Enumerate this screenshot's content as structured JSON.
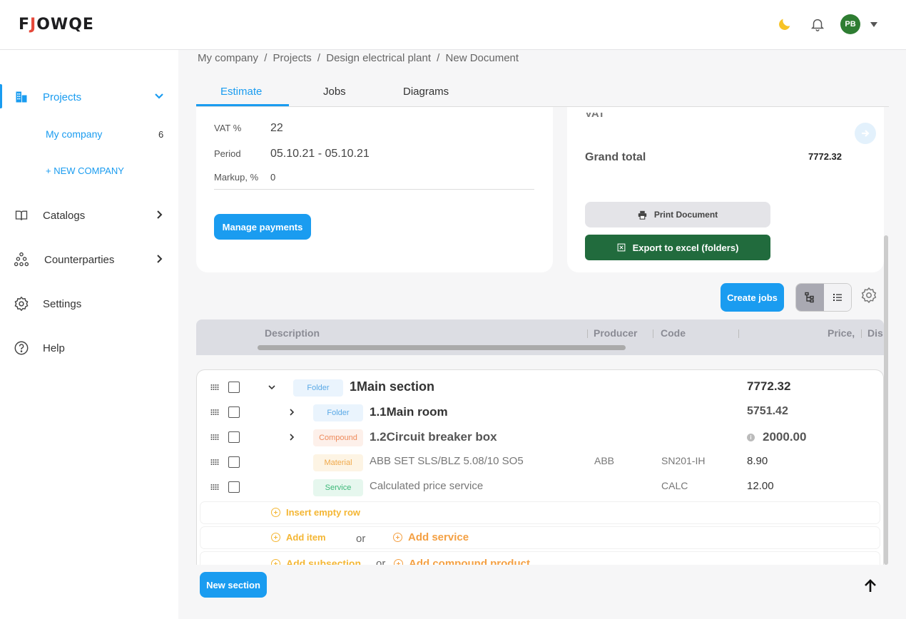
{
  "app": {
    "logo_left": "F",
    "logo_accent": "J",
    "logo_right": "OWQE",
    "user_initials": "PB"
  },
  "colors": {
    "accent": "#1a9cf0",
    "excel_green": "#216b3d",
    "avatar_green": "#2e7d32"
  },
  "sidebar": {
    "projects": "Projects",
    "my_company": "My company",
    "my_company_count": "6",
    "new_company": "+ NEW COMPANY",
    "catalogs": "Catalogs",
    "counterparties": "Counterparties",
    "settings": "Settings",
    "help": "Help"
  },
  "breadcrumb": [
    "My company",
    "Projects",
    "Design electrical plant",
    "New Document"
  ],
  "breadcrumb_sep": "/",
  "tabs": [
    "Estimate",
    "Jobs",
    "Diagrams"
  ],
  "details": {
    "vat_label": "VAT %",
    "vat_value": "22",
    "period_label": "Period",
    "period_value": "05.10.21 - 05.10.21",
    "markup_label": "Markup, %",
    "markup_value": "0",
    "manage_payments": "Manage payments"
  },
  "totals": {
    "vat_cut": "VAT",
    "grand_total_label": "Grand total",
    "grand_total_value": "7772.32",
    "print_document": "Print Document",
    "export_excel": "Export to excel (folders)"
  },
  "toolbar": {
    "create_jobs": "Create jobs"
  },
  "table": {
    "headers": {
      "description": "Description",
      "producer": "Producer",
      "code": "Code",
      "price": "Price,",
      "dis": "Dis"
    },
    "rows": [
      {
        "type": "Folder",
        "description": "1Main section",
        "producer": "",
        "code": "",
        "price": "7772.32"
      },
      {
        "type": "Folder",
        "description": "1.1Main room",
        "producer": "",
        "code": "",
        "price": "5751.42"
      },
      {
        "type": "Compound",
        "description": "1.2Circuit breaker box",
        "producer": "",
        "code": "",
        "price": "2000.00"
      },
      {
        "type": "Material",
        "description": "ABB SET SLS/BLZ 5.08/10 SO5",
        "producer": "ABB",
        "code": "SN201-IH",
        "price": "8.90"
      },
      {
        "type": "Service",
        "description": "Calculated price service",
        "producer": "",
        "code": "CALC",
        "price": "12.00"
      }
    ],
    "insert_empty_row": "Insert empty row",
    "add_item": "Add item",
    "or": "or",
    "add_service": "Add service",
    "add_subsection": "Add subsection",
    "add_compound_product": "Add compound product"
  },
  "footer": {
    "new_section": "New section"
  }
}
